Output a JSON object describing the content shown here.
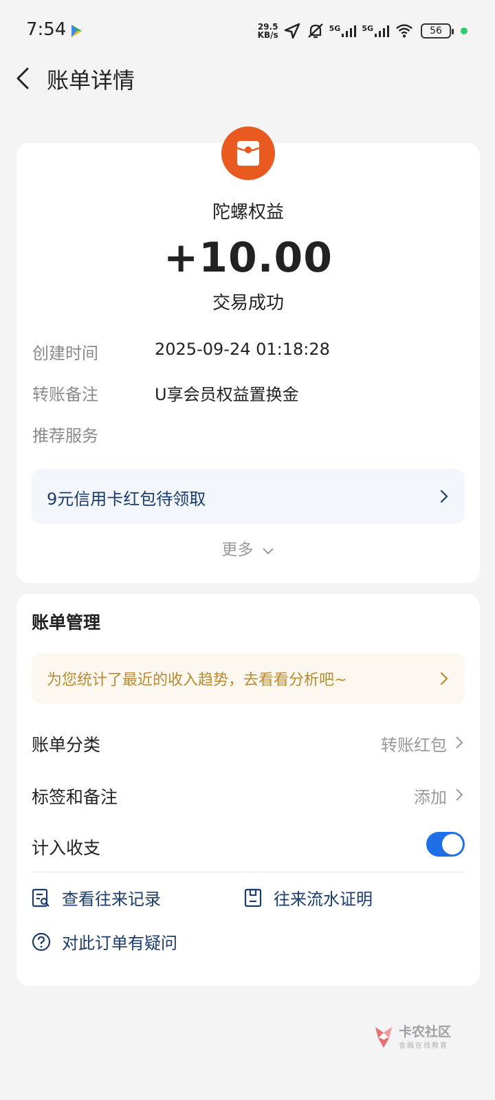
{
  "status_bar": {
    "time": "7:54",
    "net_speed_value": "29.5",
    "net_speed_unit": "KB/s",
    "signal_1_label": "5G",
    "signal_2_label": "5G",
    "battery": "56"
  },
  "header": {
    "title": "账单详情"
  },
  "transaction": {
    "merchant": "陀螺权益",
    "amount": "+10.00",
    "status": "交易成功",
    "fields": [
      {
        "label": "创建时间",
        "value": "2025-09-24 01:18:28"
      },
      {
        "label": "转账备注",
        "value": "U享会员权益置换金"
      },
      {
        "label": "推荐服务",
        "value": ""
      }
    ],
    "promo": "9元信用卡红包待领取",
    "more": "更多"
  },
  "management": {
    "title": "账单管理",
    "analysis_tip": "为您统计了最近的收入趋势，去看看分析吧~",
    "rows": [
      {
        "label": "账单分类",
        "value": "转账红包"
      },
      {
        "label": "标签和备注",
        "value": "添加"
      },
      {
        "label": "计入收支",
        "value": ""
      }
    ],
    "toggle_on": true,
    "links": {
      "records": "查看往来记录",
      "proof": "往来流水证明",
      "question": "对此订单有疑问"
    }
  },
  "watermark": {
    "name": "卡农社区",
    "tagline": "金融在线教育"
  },
  "colors": {
    "accent_blue": "#1e6fe8",
    "link_blue": "#1b3b6b",
    "merchant_orange": "#e85a1f",
    "tip_gold": "#b98a2f"
  }
}
